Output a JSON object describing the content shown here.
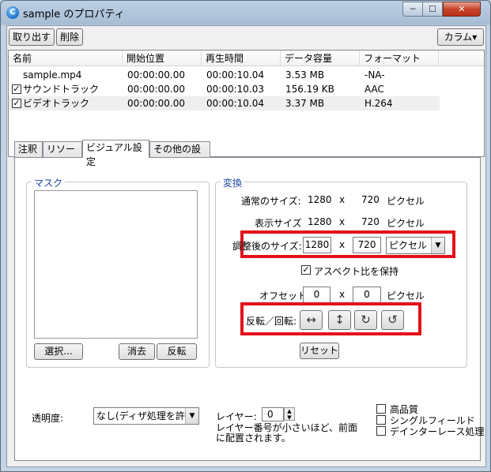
{
  "window": {
    "title": "sample のプロパティ",
    "min": "─",
    "max": "☐",
    "close": "✕"
  },
  "toolbar": {
    "extract": "取り出す",
    "delete": "削除",
    "columns": "カラム▾"
  },
  "columns": [
    "名前",
    "開始位置",
    "再生時間",
    "データ容量",
    "フォーマット"
  ],
  "rows": [
    {
      "checked": false,
      "name": "sample.mp4",
      "start": "00:00:00.00",
      "duration": "00:00:10.04",
      "size": "3.53 MB",
      "format": "-NA-"
    },
    {
      "checked": true,
      "name": "サウンドトラック",
      "start": "00:00:00.00",
      "duration": "00:00:10.03",
      "size": "156.19 KB",
      "format": "AAC"
    },
    {
      "checked": true,
      "name": "ビデオトラック",
      "start": "00:00:00.00",
      "duration": "00:00:10.04",
      "size": "3.37 MB",
      "format": "H.264"
    }
  ],
  "tabs": [
    "注釈",
    "リソース",
    "ビジュアル設定",
    "その他の設定"
  ],
  "mask": {
    "label": "マスク",
    "select": "選択...",
    "clear": "消去",
    "invert": "反転"
  },
  "transform": {
    "label": "変換",
    "normal_size_label": "通常のサイズ:",
    "normal_w": "1280",
    "normal_h": "720",
    "display_size_label": "表示サイズ",
    "display_w": "1280",
    "display_h": "720",
    "adjusted_label": "調整後のサイズ:",
    "adjusted_w": "1280",
    "adjusted_h": "720",
    "x": "x",
    "unit": "ピクセル",
    "aspect": "アスペクト比を保持",
    "offset_label": "オフセット:",
    "offset_x": "0",
    "offset_y": "0",
    "flip_label": "反転／回転:",
    "reset": "リセット"
  },
  "opacity": {
    "label": "透明度:",
    "value": "なし(ディザ処理を許可)"
  },
  "layer": {
    "label": "レイヤー:",
    "value": "0",
    "note": "レイヤー番号が小さいほど、前面に配置されます。"
  },
  "options": {
    "high_quality": "高品質",
    "single_field": "シングルフィールド",
    "deinterlace": "デインターレース処理"
  }
}
